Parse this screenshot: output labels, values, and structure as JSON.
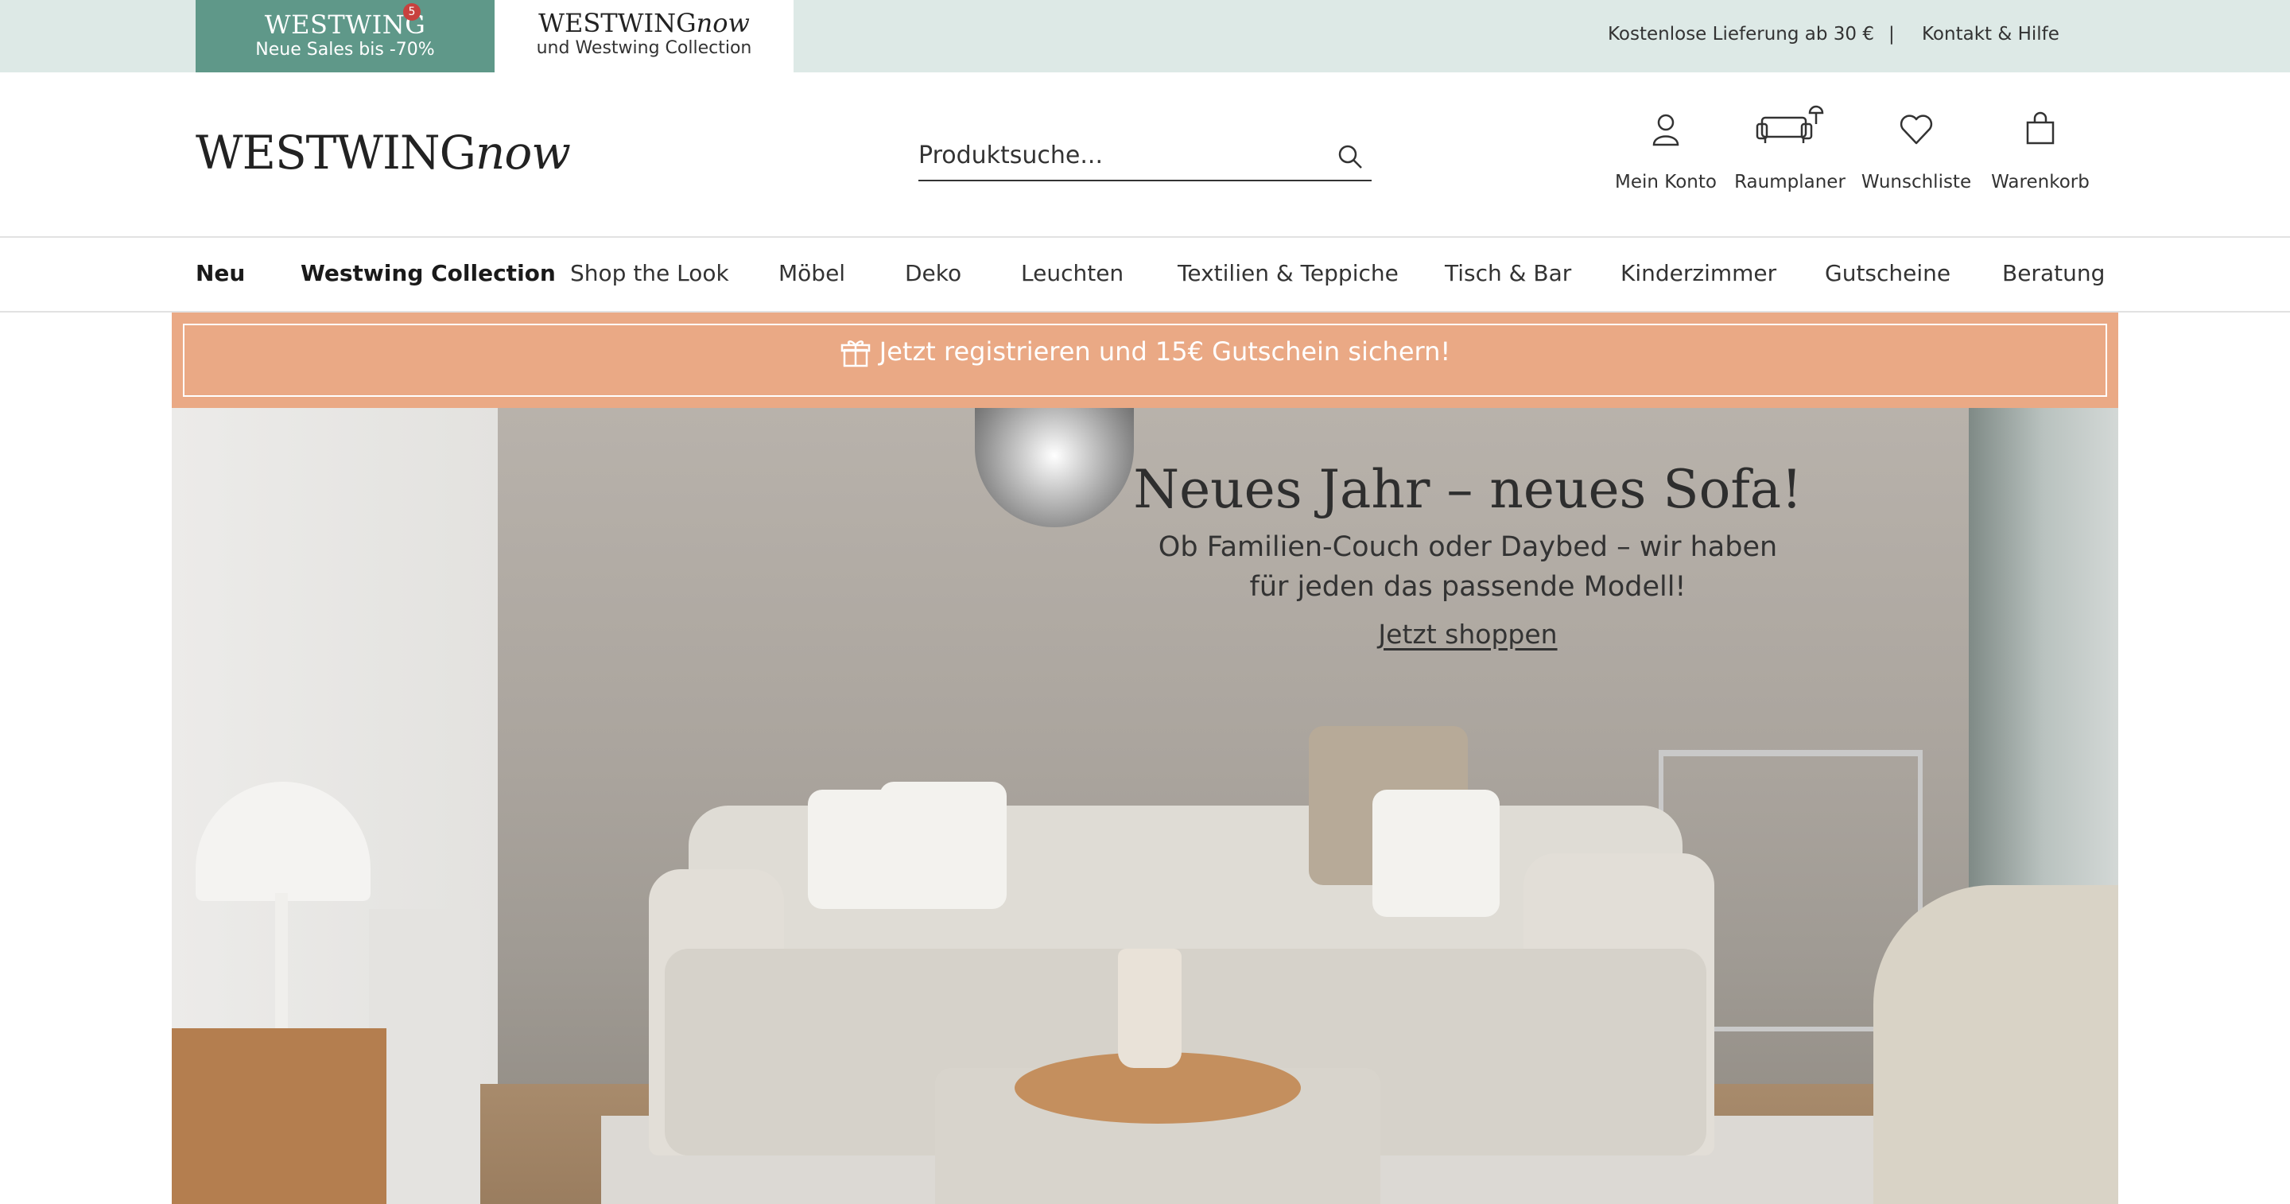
{
  "topbar": {
    "sales_brand": "WESTWING",
    "sales_badge": "5",
    "sales_text": "Neue Sales bis -70%",
    "now_brand_main": "WESTWING",
    "now_brand_italic": "now",
    "now_text": "und Westwing Collection",
    "shipping_text": "Kostenlose Lieferung ab 30 €",
    "separator": "|",
    "contact_text": "Kontakt & Hilfe"
  },
  "header": {
    "logo_main": "WESTWING",
    "logo_italic": "now",
    "search_placeholder": "Produktsuche...",
    "icons": [
      {
        "label": "Mein Konto",
        "icon": "user-icon"
      },
      {
        "label": "Raumplaner",
        "icon": "sofa-planner-icon"
      },
      {
        "label": "Wunschliste",
        "icon": "heart-icon"
      },
      {
        "label": "Warenkorb",
        "icon": "bag-icon"
      }
    ]
  },
  "nav": {
    "items": [
      "Neu",
      "Westwing Collection",
      "Shop the Look",
      "Möbel",
      "Deko",
      "Leuchten",
      "Textilien & Teppiche",
      "Tisch & Bar",
      "Kinderzimmer",
      "Gutscheine",
      "Beratung"
    ]
  },
  "promo": {
    "text": "Jetzt registrieren und 15€ Gutschein sichern!",
    "color": "#eaa985"
  },
  "hero": {
    "title": "Neues Jahr – neues Sofa!",
    "subtitle_line1": "Ob Familien-Couch oder Daybed – wir haben",
    "subtitle_line2": "für jeden das passende Modell!",
    "cta": "Jetzt shoppen"
  },
  "colors": {
    "topbar_bg": "#dde9e6",
    "sales_tab": "#5f9889",
    "badge": "#c8413e"
  }
}
